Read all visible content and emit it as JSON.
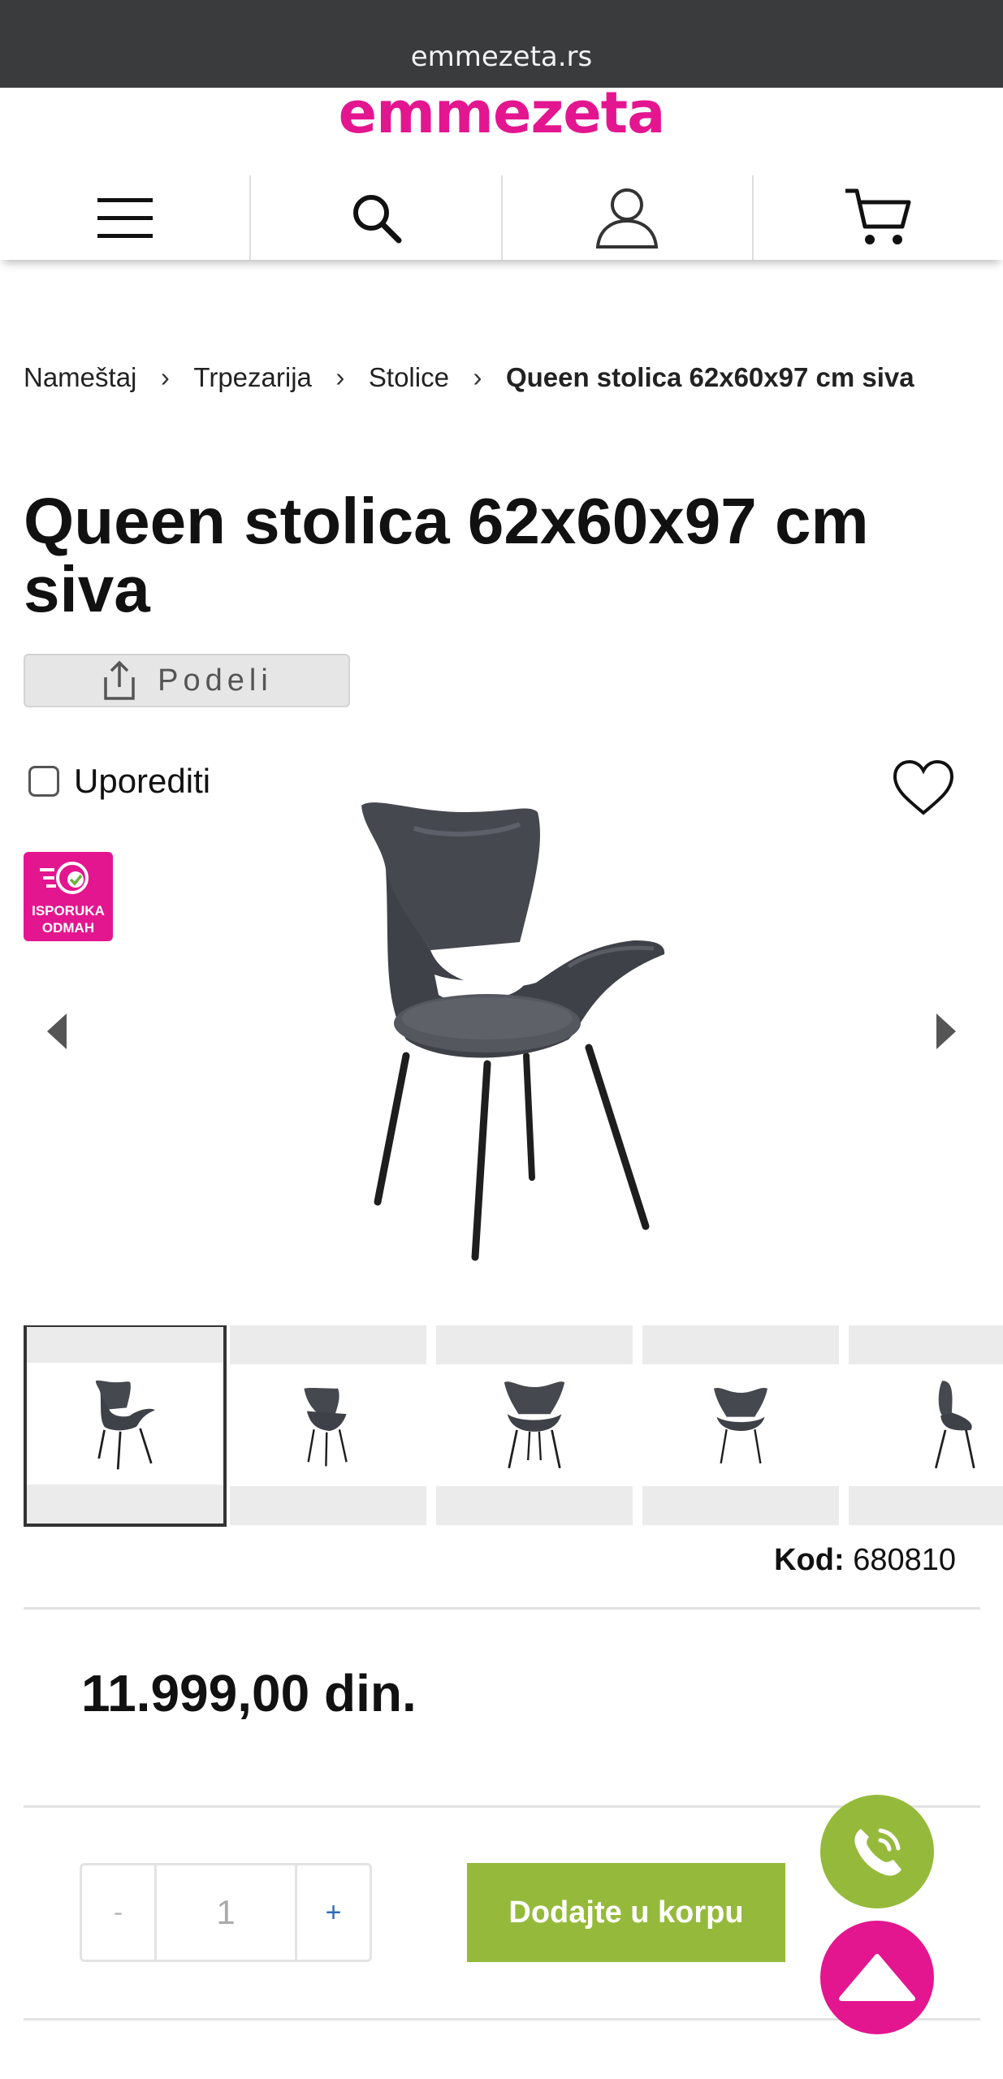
{
  "browser": {
    "url": "emmezeta.rs"
  },
  "brand": {
    "logo_text": "emmezeta",
    "color": "#e3168f"
  },
  "nav": {
    "icons": [
      "menu-icon",
      "search-icon",
      "user-icon",
      "cart-icon"
    ]
  },
  "breadcrumb": {
    "items": [
      "Nameštaj",
      "Trpezarija",
      "Stolice"
    ],
    "current": "Queen stolica 62x60x97 cm siva"
  },
  "product": {
    "title": "Queen stolica 62x60x97 cm siva",
    "share_label": "Podeli",
    "compare_label": "Uporediti",
    "badge": {
      "line1": "ISPORUKA",
      "line2": "ODMAH"
    },
    "code_label": "Kod:",
    "code_value": "680810",
    "price": "11.999,00 din.",
    "thumbnail_count": 5
  },
  "cart": {
    "minus_label": "-",
    "quantity": "1",
    "plus_label": "+",
    "add_label": "Dodajte u korpu",
    "button_color": "#95ba3b"
  },
  "fabs": {
    "phone_icon": "phone-icon",
    "scroll_top_icon": "arrow-up-icon"
  }
}
